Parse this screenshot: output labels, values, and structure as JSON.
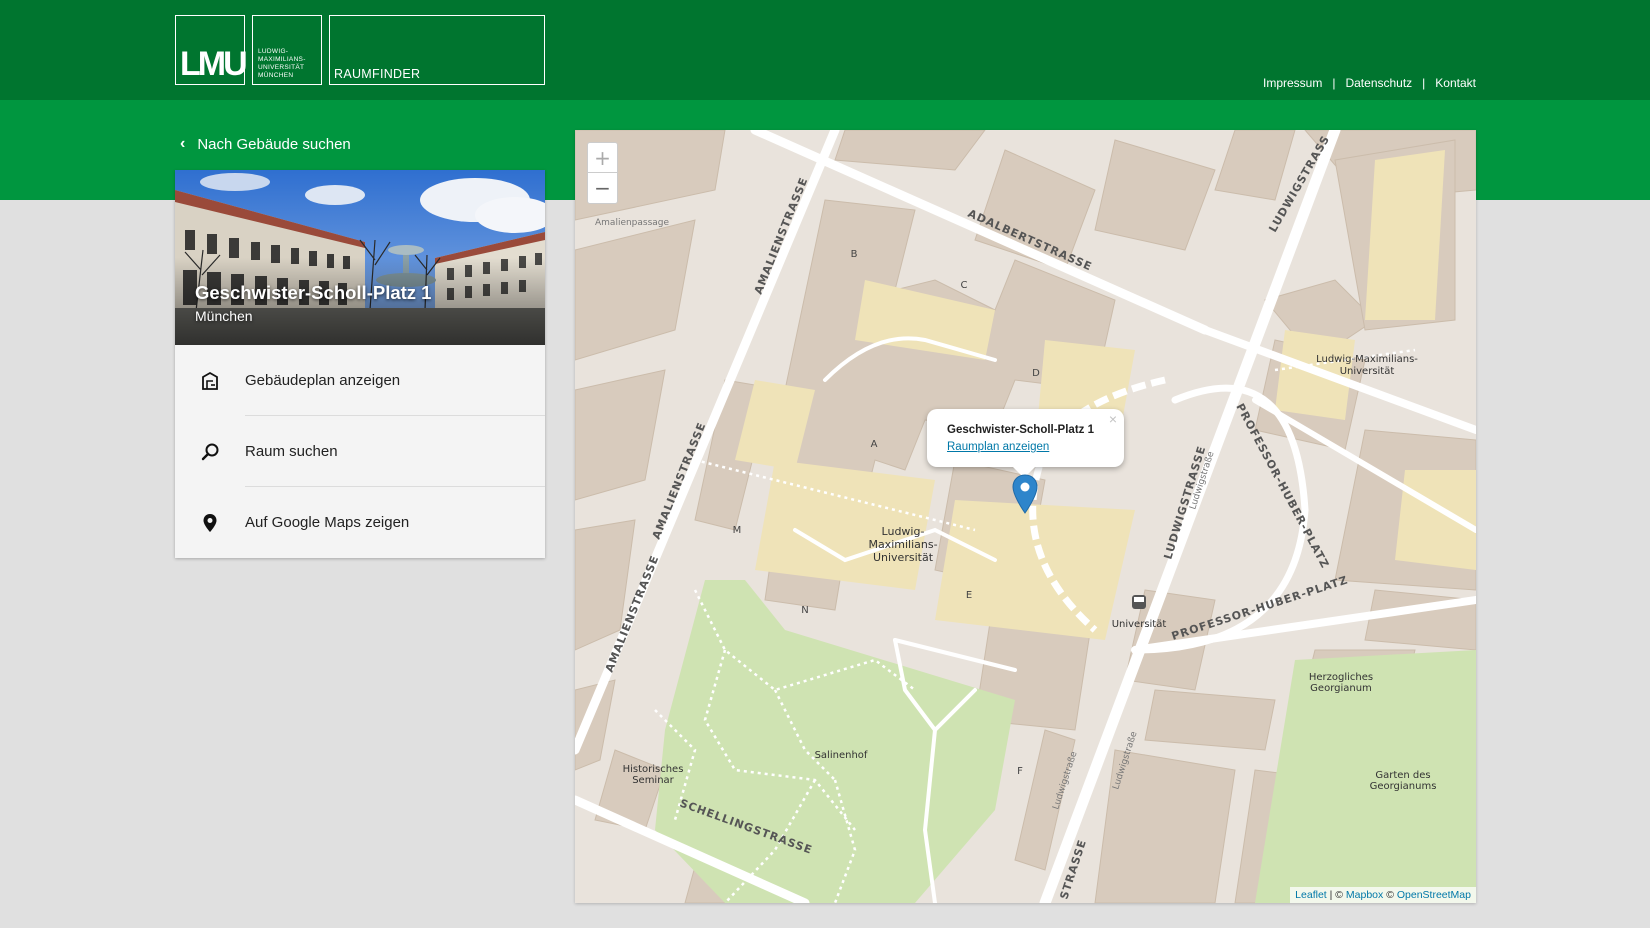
{
  "header": {
    "logo_lmu": "LMU",
    "logo_university_lines": [
      "LUDWIG-",
      "MAXIMILIANS-",
      "UNIVERSITÄT",
      "MÜNCHEN"
    ],
    "app_title": "RAUMFINDER",
    "links": [
      "Impressum",
      "Datenschutz",
      "Kontakt"
    ]
  },
  "back_link": "Nach Gebäude suchen",
  "building": {
    "title": "Geschwister-Scholl-Platz 1",
    "city": "München"
  },
  "menu": [
    {
      "label": "Gebäudeplan anzeigen",
      "icon": "floorplan-icon"
    },
    {
      "label": "Raum suchen",
      "icon": "search-icon"
    },
    {
      "label": "Auf Google Maps zeigen",
      "icon": "map-pin-icon"
    }
  ],
  "map": {
    "zoom_in": "+",
    "zoom_out": "−",
    "popup_title": "Geschwister-Scholl-Platz 1",
    "popup_link": "Raumplan anzeigen",
    "popup_close": "×",
    "attribution": {
      "leaflet": "Leaflet",
      "sep": " | © ",
      "mapbox": "Mapbox",
      "copy": " © ",
      "osm": "OpenStreetMap"
    }
  },
  "colors": {
    "header_dark": "#00752f",
    "header_band": "#00963f",
    "link_blue": "#0078a8",
    "marker_blue": "#2e85cb"
  }
}
